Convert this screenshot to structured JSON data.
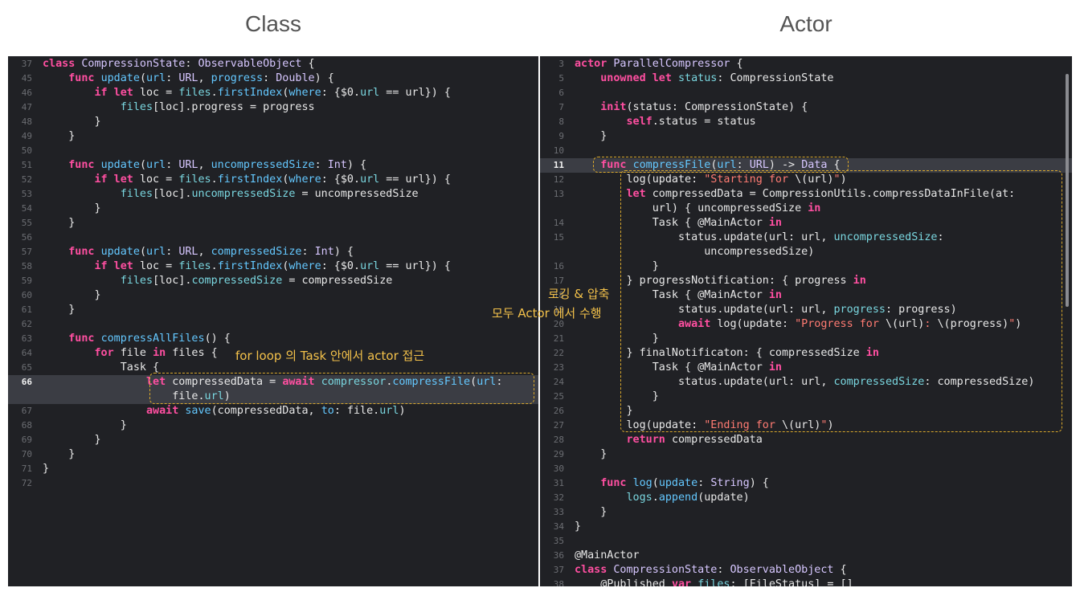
{
  "titles": {
    "left": "Class",
    "right": "Actor"
  },
  "left_code": [
    {
      "n": "37",
      "t": [
        [
          "kw",
          "class "
        ],
        [
          "ty",
          "CompressionState"
        ],
        [
          "plain",
          ": "
        ],
        [
          "ty",
          "ObservableObject"
        ],
        [
          "plain",
          " {"
        ]
      ]
    },
    {
      "n": "45",
      "t": [
        [
          "plain",
          "    "
        ],
        [
          "kw",
          "func "
        ],
        [
          "fn",
          "update"
        ],
        [
          "plain",
          "("
        ],
        [
          "fn",
          "url"
        ],
        [
          "plain",
          ": "
        ],
        [
          "ty",
          "URL"
        ],
        [
          "plain",
          ", "
        ],
        [
          "fn",
          "progress"
        ],
        [
          "plain",
          ": "
        ],
        [
          "ty",
          "Double"
        ],
        [
          "plain",
          ") {"
        ]
      ]
    },
    {
      "n": "46",
      "t": [
        [
          "plain",
          "        "
        ],
        [
          "kw",
          "if let "
        ],
        [
          "plain",
          "loc = "
        ],
        [
          "prop",
          "files"
        ],
        [
          "plain",
          "."
        ],
        [
          "fn",
          "firstIndex"
        ],
        [
          "plain",
          "("
        ],
        [
          "fn",
          "where"
        ],
        [
          "plain",
          ": {$0."
        ],
        [
          "prop",
          "url"
        ],
        [
          "plain",
          " == url}) {"
        ]
      ]
    },
    {
      "n": "47",
      "t": [
        [
          "plain",
          "            "
        ],
        [
          "prop",
          "files"
        ],
        [
          "plain",
          "[loc].progress = progress"
        ]
      ]
    },
    {
      "n": "48",
      "t": [
        [
          "plain",
          "        }"
        ]
      ]
    },
    {
      "n": "49",
      "t": [
        [
          "plain",
          "    }"
        ]
      ]
    },
    {
      "n": "50",
      "t": []
    },
    {
      "n": "51",
      "t": [
        [
          "plain",
          "    "
        ],
        [
          "kw",
          "func "
        ],
        [
          "fn",
          "update"
        ],
        [
          "plain",
          "("
        ],
        [
          "fn",
          "url"
        ],
        [
          "plain",
          ": "
        ],
        [
          "ty",
          "URL"
        ],
        [
          "plain",
          ", "
        ],
        [
          "fn",
          "uncompressedSize"
        ],
        [
          "plain",
          ": "
        ],
        [
          "ty",
          "Int"
        ],
        [
          "plain",
          ") {"
        ]
      ]
    },
    {
      "n": "52",
      "t": [
        [
          "plain",
          "        "
        ],
        [
          "kw",
          "if let "
        ],
        [
          "plain",
          "loc = "
        ],
        [
          "prop",
          "files"
        ],
        [
          "plain",
          "."
        ],
        [
          "fn",
          "firstIndex"
        ],
        [
          "plain",
          "("
        ],
        [
          "fn",
          "where"
        ],
        [
          "plain",
          ": {$0."
        ],
        [
          "prop",
          "url"
        ],
        [
          "plain",
          " == url}) {"
        ]
      ]
    },
    {
      "n": "53",
      "t": [
        [
          "plain",
          "            "
        ],
        [
          "prop",
          "files"
        ],
        [
          "plain",
          "[loc]."
        ],
        [
          "prop",
          "uncompressedSize"
        ],
        [
          "plain",
          " = uncompressedSize"
        ]
      ]
    },
    {
      "n": "54",
      "t": [
        [
          "plain",
          "        }"
        ]
      ]
    },
    {
      "n": "55",
      "t": [
        [
          "plain",
          "    }"
        ]
      ]
    },
    {
      "n": "56",
      "t": []
    },
    {
      "n": "57",
      "t": [
        [
          "plain",
          "    "
        ],
        [
          "kw",
          "func "
        ],
        [
          "fn",
          "update"
        ],
        [
          "plain",
          "("
        ],
        [
          "fn",
          "url"
        ],
        [
          "plain",
          ": "
        ],
        [
          "ty",
          "URL"
        ],
        [
          "plain",
          ", "
        ],
        [
          "fn",
          "compressedSize"
        ],
        [
          "plain",
          ": "
        ],
        [
          "ty",
          "Int"
        ],
        [
          "plain",
          ") {"
        ]
      ]
    },
    {
      "n": "58",
      "t": [
        [
          "plain",
          "        "
        ],
        [
          "kw",
          "if let "
        ],
        [
          "plain",
          "loc = "
        ],
        [
          "prop",
          "files"
        ],
        [
          "plain",
          "."
        ],
        [
          "fn",
          "firstIndex"
        ],
        [
          "plain",
          "("
        ],
        [
          "fn",
          "where"
        ],
        [
          "plain",
          ": {$0."
        ],
        [
          "prop",
          "url"
        ],
        [
          "plain",
          " == url}) {"
        ]
      ]
    },
    {
      "n": "59",
      "t": [
        [
          "plain",
          "            "
        ],
        [
          "prop",
          "files"
        ],
        [
          "plain",
          "[loc]."
        ],
        [
          "prop",
          "compressedSize"
        ],
        [
          "plain",
          " = compressedSize"
        ]
      ]
    },
    {
      "n": "60",
      "t": [
        [
          "plain",
          "        }"
        ]
      ]
    },
    {
      "n": "61",
      "t": [
        [
          "plain",
          "    }"
        ]
      ]
    },
    {
      "n": "62",
      "t": []
    },
    {
      "n": "63",
      "t": [
        [
          "plain",
          "    "
        ],
        [
          "kw",
          "func "
        ],
        [
          "fn",
          "compressAllFiles"
        ],
        [
          "plain",
          "() {"
        ]
      ]
    },
    {
      "n": "64",
      "t": [
        [
          "plain",
          "        "
        ],
        [
          "kw",
          "for "
        ],
        [
          "plain",
          "file "
        ],
        [
          "kw",
          "in "
        ],
        [
          "plain",
          "files {"
        ]
      ]
    },
    {
      "n": "65",
      "t": [
        [
          "plain",
          "            Task {"
        ]
      ]
    },
    {
      "n": "66",
      "hl": true,
      "t": [
        [
          "plain",
          "                "
        ],
        [
          "kw",
          "let "
        ],
        [
          "plain",
          "compressedData = "
        ],
        [
          "kw",
          "await "
        ],
        [
          "prop",
          "compressor"
        ],
        [
          "plain",
          "."
        ],
        [
          "fn",
          "compressFile"
        ],
        [
          "plain",
          "("
        ],
        [
          "fn",
          "url"
        ],
        [
          "plain",
          ":"
        ]
      ]
    },
    {
      "n": "",
      "hl": true,
      "t": [
        [
          "plain",
          "                    file."
        ],
        [
          "prop",
          "url"
        ],
        [
          "plain",
          ")"
        ]
      ]
    },
    {
      "n": "67",
      "t": [
        [
          "plain",
          "                "
        ],
        [
          "kw",
          "await "
        ],
        [
          "fn",
          "save"
        ],
        [
          "plain",
          "(compressedData, "
        ],
        [
          "fn",
          "to"
        ],
        [
          "plain",
          ": file."
        ],
        [
          "prop",
          "url"
        ],
        [
          "plain",
          ")"
        ]
      ]
    },
    {
      "n": "68",
      "t": [
        [
          "plain",
          "            }"
        ]
      ]
    },
    {
      "n": "69",
      "t": [
        [
          "plain",
          "        }"
        ]
      ]
    },
    {
      "n": "70",
      "t": [
        [
          "plain",
          "    }"
        ]
      ]
    },
    {
      "n": "71",
      "t": [
        [
          "plain",
          "}"
        ]
      ]
    },
    {
      "n": "72",
      "t": []
    }
  ],
  "right_code": [
    {
      "n": "3",
      "t": [
        [
          "kw",
          "actor "
        ],
        [
          "ty",
          "ParallelCompressor"
        ],
        [
          "plain",
          " {"
        ]
      ]
    },
    {
      "n": "5",
      "t": [
        [
          "plain",
          "    "
        ],
        [
          "kw",
          "unowned let "
        ],
        [
          "prop",
          "status"
        ],
        [
          "plain",
          ": CompressionState"
        ]
      ]
    },
    {
      "n": "6",
      "t": []
    },
    {
      "n": "7",
      "t": [
        [
          "plain",
          "    "
        ],
        [
          "kw",
          "init"
        ],
        [
          "plain",
          "(status: CompressionState) {"
        ]
      ]
    },
    {
      "n": "8",
      "t": [
        [
          "plain",
          "        "
        ],
        [
          "kw",
          "self"
        ],
        [
          "plain",
          ".status = status"
        ]
      ]
    },
    {
      "n": "9",
      "t": [
        [
          "plain",
          "    }"
        ]
      ]
    },
    {
      "n": "10",
      "t": []
    },
    {
      "n": "11",
      "hl": true,
      "t": [
        [
          "plain",
          "    "
        ],
        [
          "kw",
          "func "
        ],
        [
          "fn",
          "compressFile"
        ],
        [
          "plain",
          "("
        ],
        [
          "fn",
          "url"
        ],
        [
          "plain",
          ": "
        ],
        [
          "ty",
          "URL"
        ],
        [
          "plain",
          ") -> "
        ],
        [
          "ty",
          "Data"
        ],
        [
          "plain",
          " {"
        ]
      ]
    },
    {
      "n": "12",
      "t": [
        [
          "plain",
          "        log(update: "
        ],
        [
          "str",
          "\"Starting for "
        ],
        [
          "plain",
          "\\(url)"
        ],
        [
          "str",
          "\""
        ],
        [
          "plain",
          ")"
        ]
      ]
    },
    {
      "n": "13",
      "t": [
        [
          "plain",
          "        "
        ],
        [
          "kw",
          "let "
        ],
        [
          "plain",
          "compressedData = CompressionUtils.compressDataInFile(at:"
        ]
      ]
    },
    {
      "n": "",
      "t": [
        [
          "plain",
          "            url) { uncompressedSize "
        ],
        [
          "kw",
          "in"
        ]
      ]
    },
    {
      "n": "14",
      "t": [
        [
          "plain",
          "            Task { @MainActor "
        ],
        [
          "kw",
          "in"
        ]
      ]
    },
    {
      "n": "15",
      "t": [
        [
          "plain",
          "                status.update(url: url, "
        ],
        [
          "prop",
          "uncompressedSize"
        ],
        [
          "plain",
          ":"
        ]
      ]
    },
    {
      "n": "",
      "t": [
        [
          "plain",
          "                    uncompressedSize)"
        ]
      ]
    },
    {
      "n": "16",
      "t": [
        [
          "plain",
          "            }"
        ]
      ]
    },
    {
      "n": "17",
      "t": [
        [
          "plain",
          "        } progressNotification: { progress "
        ],
        [
          "kw",
          "in"
        ]
      ]
    },
    {
      "n": "18",
      "t": [
        [
          "plain",
          "            Task { @MainActor "
        ],
        [
          "kw",
          "in"
        ]
      ]
    },
    {
      "n": "19",
      "t": [
        [
          "plain",
          "                status.update(url: url, "
        ],
        [
          "prop",
          "progress"
        ],
        [
          "plain",
          ": progress)"
        ]
      ]
    },
    {
      "n": "20",
      "t": [
        [
          "plain",
          "                "
        ],
        [
          "kw",
          "await "
        ],
        [
          "plain",
          "log(update: "
        ],
        [
          "str",
          "\"Progress for "
        ],
        [
          "plain",
          "\\(url)"
        ],
        [
          "str",
          ": "
        ],
        [
          "plain",
          "\\(progress)"
        ],
        [
          "str",
          "\""
        ],
        [
          "plain",
          ")"
        ]
      ]
    },
    {
      "n": "21",
      "t": [
        [
          "plain",
          "            }"
        ]
      ]
    },
    {
      "n": "22",
      "t": [
        [
          "plain",
          "        } finalNotificaton: { compressedSize "
        ],
        [
          "kw",
          "in"
        ]
      ]
    },
    {
      "n": "23",
      "t": [
        [
          "plain",
          "            Task { @MainActor "
        ],
        [
          "kw",
          "in"
        ]
      ]
    },
    {
      "n": "24",
      "t": [
        [
          "plain",
          "                status.update(url: url, "
        ],
        [
          "prop",
          "compressedSize"
        ],
        [
          "plain",
          ": compressedSize)"
        ]
      ]
    },
    {
      "n": "25",
      "t": [
        [
          "plain",
          "            }"
        ]
      ]
    },
    {
      "n": "26",
      "t": [
        [
          "plain",
          "        }"
        ]
      ]
    },
    {
      "n": "27",
      "t": [
        [
          "plain",
          "        log(update: "
        ],
        [
          "str",
          "\"Ending for "
        ],
        [
          "plain",
          "\\(url)"
        ],
        [
          "str",
          "\""
        ],
        [
          "plain",
          ")"
        ]
      ]
    },
    {
      "n": "28",
      "t": [
        [
          "plain",
          "        "
        ],
        [
          "kw",
          "return "
        ],
        [
          "plain",
          "compressedData"
        ]
      ]
    },
    {
      "n": "29",
      "t": [
        [
          "plain",
          "    }"
        ]
      ]
    },
    {
      "n": "30",
      "t": []
    },
    {
      "n": "31",
      "t": [
        [
          "plain",
          "    "
        ],
        [
          "kw",
          "func "
        ],
        [
          "fn",
          "log"
        ],
        [
          "plain",
          "("
        ],
        [
          "fn",
          "update"
        ],
        [
          "plain",
          ": "
        ],
        [
          "ty",
          "String"
        ],
        [
          "plain",
          ") {"
        ]
      ]
    },
    {
      "n": "32",
      "t": [
        [
          "plain",
          "        "
        ],
        [
          "prop",
          "logs"
        ],
        [
          "plain",
          "."
        ],
        [
          "fn",
          "append"
        ],
        [
          "plain",
          "(update)"
        ]
      ]
    },
    {
      "n": "33",
      "t": [
        [
          "plain",
          "    }"
        ]
      ]
    },
    {
      "n": "34",
      "t": [
        [
          "plain",
          "}"
        ]
      ]
    },
    {
      "n": "35",
      "t": []
    },
    {
      "n": "36",
      "t": [
        [
          "plain",
          "@MainActor"
        ]
      ]
    },
    {
      "n": "37",
      "t": [
        [
          "kw",
          "class "
        ],
        [
          "ty",
          "CompressionState"
        ],
        [
          "plain",
          ": "
        ],
        [
          "ty",
          "ObservableObject"
        ],
        [
          "plain",
          " {"
        ]
      ]
    },
    {
      "n": "38",
      "t": [
        [
          "plain",
          "    @Published "
        ],
        [
          "kw",
          "var "
        ],
        [
          "prop",
          "files"
        ],
        [
          "plain",
          ": [FileStatus] = []"
        ]
      ]
    }
  ],
  "annotations": {
    "left_note": "for loop 의 Task 안에서 actor 접근",
    "right_note_line1": "로깅 & 압축",
    "right_note_line2": "모두 Actor 에서 수행"
  },
  "colors": {
    "keyword": "#ff4fa1",
    "type": "#d7c7ff",
    "function": "#64c8ff",
    "string": "#ff7b72",
    "property": "#7ad7e0",
    "annotation": "#f3c14a",
    "editor_bg": "#202125"
  }
}
